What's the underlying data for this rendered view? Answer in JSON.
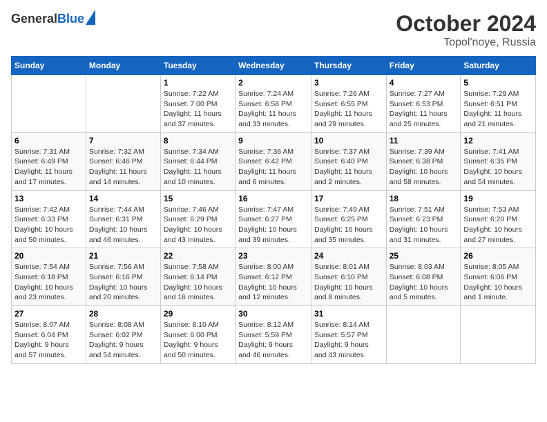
{
  "header": {
    "logo_general": "General",
    "logo_blue": "Blue",
    "title": "October 2024",
    "subtitle": "Topol'noye, Russia"
  },
  "days_of_week": [
    "Sunday",
    "Monday",
    "Tuesday",
    "Wednesday",
    "Thursday",
    "Friday",
    "Saturday"
  ],
  "weeks": [
    [
      {
        "day": "",
        "info": ""
      },
      {
        "day": "",
        "info": ""
      },
      {
        "day": "1",
        "info": "Sunrise: 7:22 AM\nSunset: 7:00 PM\nDaylight: 11 hours\nand 37 minutes."
      },
      {
        "day": "2",
        "info": "Sunrise: 7:24 AM\nSunset: 6:58 PM\nDaylight: 11 hours\nand 33 minutes."
      },
      {
        "day": "3",
        "info": "Sunrise: 7:26 AM\nSunset: 6:55 PM\nDaylight: 11 hours\nand 29 minutes."
      },
      {
        "day": "4",
        "info": "Sunrise: 7:27 AM\nSunset: 6:53 PM\nDaylight: 11 hours\nand 25 minutes."
      },
      {
        "day": "5",
        "info": "Sunrise: 7:29 AM\nSunset: 6:51 PM\nDaylight: 11 hours\nand 21 minutes."
      }
    ],
    [
      {
        "day": "6",
        "info": "Sunrise: 7:31 AM\nSunset: 6:49 PM\nDaylight: 11 hours\nand 17 minutes."
      },
      {
        "day": "7",
        "info": "Sunrise: 7:32 AM\nSunset: 6:46 PM\nDaylight: 11 hours\nand 14 minutes."
      },
      {
        "day": "8",
        "info": "Sunrise: 7:34 AM\nSunset: 6:44 PM\nDaylight: 11 hours\nand 10 minutes."
      },
      {
        "day": "9",
        "info": "Sunrise: 7:36 AM\nSunset: 6:42 PM\nDaylight: 11 hours\nand 6 minutes."
      },
      {
        "day": "10",
        "info": "Sunrise: 7:37 AM\nSunset: 6:40 PM\nDaylight: 11 hours\nand 2 minutes."
      },
      {
        "day": "11",
        "info": "Sunrise: 7:39 AM\nSunset: 6:38 PM\nDaylight: 10 hours\nand 58 minutes."
      },
      {
        "day": "12",
        "info": "Sunrise: 7:41 AM\nSunset: 6:35 PM\nDaylight: 10 hours\nand 54 minutes."
      }
    ],
    [
      {
        "day": "13",
        "info": "Sunrise: 7:42 AM\nSunset: 6:33 PM\nDaylight: 10 hours\nand 50 minutes."
      },
      {
        "day": "14",
        "info": "Sunrise: 7:44 AM\nSunset: 6:31 PM\nDaylight: 10 hours\nand 46 minutes."
      },
      {
        "day": "15",
        "info": "Sunrise: 7:46 AM\nSunset: 6:29 PM\nDaylight: 10 hours\nand 43 minutes."
      },
      {
        "day": "16",
        "info": "Sunrise: 7:47 AM\nSunset: 6:27 PM\nDaylight: 10 hours\nand 39 minutes."
      },
      {
        "day": "17",
        "info": "Sunrise: 7:49 AM\nSunset: 6:25 PM\nDaylight: 10 hours\nand 35 minutes."
      },
      {
        "day": "18",
        "info": "Sunrise: 7:51 AM\nSunset: 6:23 PM\nDaylight: 10 hours\nand 31 minutes."
      },
      {
        "day": "19",
        "info": "Sunrise: 7:53 AM\nSunset: 6:20 PM\nDaylight: 10 hours\nand 27 minutes."
      }
    ],
    [
      {
        "day": "20",
        "info": "Sunrise: 7:54 AM\nSunset: 6:18 PM\nDaylight: 10 hours\nand 23 minutes."
      },
      {
        "day": "21",
        "info": "Sunrise: 7:56 AM\nSunset: 6:16 PM\nDaylight: 10 hours\nand 20 minutes."
      },
      {
        "day": "22",
        "info": "Sunrise: 7:58 AM\nSunset: 6:14 PM\nDaylight: 10 hours\nand 16 minutes."
      },
      {
        "day": "23",
        "info": "Sunrise: 8:00 AM\nSunset: 6:12 PM\nDaylight: 10 hours\nand 12 minutes."
      },
      {
        "day": "24",
        "info": "Sunrise: 8:01 AM\nSunset: 6:10 PM\nDaylight: 10 hours\nand 8 minutes."
      },
      {
        "day": "25",
        "info": "Sunrise: 8:03 AM\nSunset: 6:08 PM\nDaylight: 10 hours\nand 5 minutes."
      },
      {
        "day": "26",
        "info": "Sunrise: 8:05 AM\nSunset: 6:06 PM\nDaylight: 10 hours\nand 1 minute."
      }
    ],
    [
      {
        "day": "27",
        "info": "Sunrise: 8:07 AM\nSunset: 6:04 PM\nDaylight: 9 hours\nand 57 minutes."
      },
      {
        "day": "28",
        "info": "Sunrise: 8:08 AM\nSunset: 6:02 PM\nDaylight: 9 hours\nand 54 minutes."
      },
      {
        "day": "29",
        "info": "Sunrise: 8:10 AM\nSunset: 6:00 PM\nDaylight: 9 hours\nand 50 minutes."
      },
      {
        "day": "30",
        "info": "Sunrise: 8:12 AM\nSunset: 5:59 PM\nDaylight: 9 hours\nand 46 minutes."
      },
      {
        "day": "31",
        "info": "Sunrise: 8:14 AM\nSunset: 5:57 PM\nDaylight: 9 hours\nand 43 minutes."
      },
      {
        "day": "",
        "info": ""
      },
      {
        "day": "",
        "info": ""
      }
    ]
  ]
}
